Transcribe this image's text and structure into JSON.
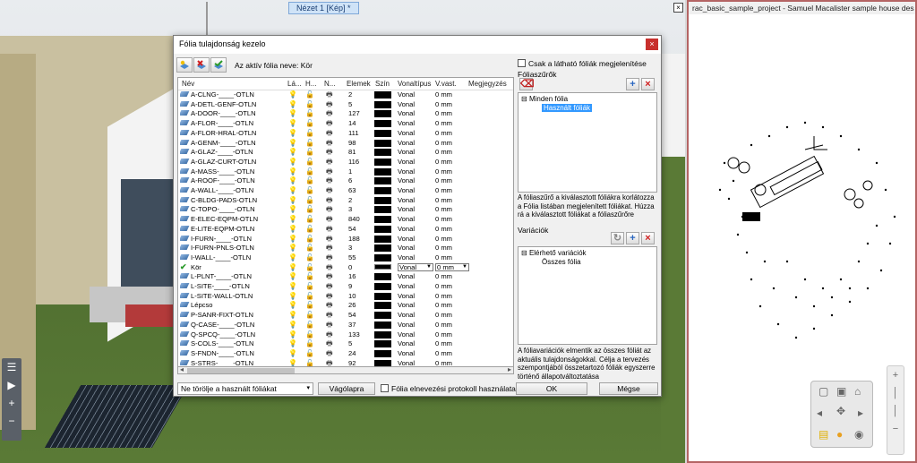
{
  "viewport": {
    "tab_label": "Nézet 1 [Kép] *",
    "close_glyph": "×",
    "tools": [
      "☰",
      "▶",
      "+",
      "−"
    ]
  },
  "view2d": {
    "title": "rac_basic_sample_project - Samuel Macalister sample house des"
  },
  "navcube": {
    "icons": [
      "cube-icon",
      "cube-top-icon",
      "house-icon",
      "arrow-left-icon",
      "orbit-icon",
      "arrow-right-icon",
      "panel-icon",
      "sun-icon",
      "eye-icon"
    ]
  },
  "dialog": {
    "title": "Fólia tulajdonság kezelo",
    "close_glyph": "×",
    "active_layer_label": "Az aktív fólia neve: Kör",
    "columns": [
      "Név",
      "Lá...",
      "H...",
      "N...",
      "Elemek",
      "Szín",
      "Vonaltípus",
      "V.vast.",
      "Megjegyzés"
    ],
    "current_row": {
      "name": "Kör",
      "count": "0",
      "line_type": "Vonal",
      "width": "0 mm"
    },
    "rows": [
      {
        "name": "A-CLNG-____-OTLN",
        "count": "2",
        "line_type": "Vonal",
        "width": "0 mm"
      },
      {
        "name": "A-DETL-GENF-OTLN",
        "count": "5",
        "line_type": "Vonal",
        "width": "0 mm"
      },
      {
        "name": "A-DOOR-____-OTLN",
        "count": "127",
        "line_type": "Vonal",
        "width": "0 mm"
      },
      {
        "name": "A-FLOR-____-OTLN",
        "count": "14",
        "line_type": "Vonal",
        "width": "0 mm"
      },
      {
        "name": "A-FLOR-HRAL-OTLN",
        "count": "111",
        "line_type": "Vonal",
        "width": "0 mm"
      },
      {
        "name": "A-GENM-____-OTLN",
        "count": "98",
        "line_type": "Vonal",
        "width": "0 mm"
      },
      {
        "name": "A-GLAZ-____-OTLN",
        "count": "81",
        "line_type": "Vonal",
        "width": "0 mm"
      },
      {
        "name": "A-GLAZ-CURT-OTLN",
        "count": "116",
        "line_type": "Vonal",
        "width": "0 mm"
      },
      {
        "name": "A-MASS-____-OTLN",
        "count": "1",
        "line_type": "Vonal",
        "width": "0 mm"
      },
      {
        "name": "A-ROOF-____-OTLN",
        "count": "6",
        "line_type": "Vonal",
        "width": "0 mm"
      },
      {
        "name": "A-WALL-____-OTLN",
        "count": "63",
        "line_type": "Vonal",
        "width": "0 mm"
      },
      {
        "name": "C-BLDG-PADS-OTLN",
        "count": "2",
        "line_type": "Vonal",
        "width": "0 mm"
      },
      {
        "name": "C-TOPO-____-OTLN",
        "count": "3",
        "line_type": "Vonal",
        "width": "0 mm"
      },
      {
        "name": "E-ELEC-EQPM-OTLN",
        "count": "840",
        "line_type": "Vonal",
        "width": "0 mm"
      },
      {
        "name": "E-LITE-EQPM-OTLN",
        "count": "54",
        "line_type": "Vonal",
        "width": "0 mm"
      },
      {
        "name": "I-FURN-____-OTLN",
        "count": "188",
        "line_type": "Vonal",
        "width": "0 mm"
      },
      {
        "name": "I-FURN-PNLS-OTLN",
        "count": "3",
        "line_type": "Vonal",
        "width": "0 mm"
      },
      {
        "name": "I-WALL-____-OTLN",
        "count": "55",
        "line_type": "Vonal",
        "width": "0 mm"
      },
      {
        "name": "L-PLNT-____-OTLN",
        "count": "16",
        "line_type": "Vonal",
        "width": "0 mm"
      },
      {
        "name": "L-SITE-____-OTLN",
        "count": "9",
        "line_type": "Vonal",
        "width": "0 mm"
      },
      {
        "name": "L-SITE-WALL-OTLN",
        "count": "10",
        "line_type": "Vonal",
        "width": "0 mm"
      },
      {
        "name": "Lépcso",
        "count": "26",
        "line_type": "Vonal",
        "width": "0 mm"
      },
      {
        "name": "P-SANR-FIXT-OTLN",
        "count": "54",
        "line_type": "Vonal",
        "width": "0 mm"
      },
      {
        "name": "Q-CASE-____-OTLN",
        "count": "37",
        "line_type": "Vonal",
        "width": "0 mm"
      },
      {
        "name": "Q-SPCQ-____-OTLN",
        "count": "133",
        "line_type": "Vonal",
        "width": "0 mm"
      },
      {
        "name": "S-COLS-____-OTLN",
        "count": "5",
        "line_type": "Vonal",
        "width": "0 mm"
      },
      {
        "name": "S-FNDN-____-OTLN",
        "count": "24",
        "line_type": "Vonal",
        "width": "0 mm"
      },
      {
        "name": "S-STRS-____-OTLN",
        "count": "92",
        "line_type": "Vonal",
        "width": "0 mm"
      }
    ],
    "current_row_index": 18,
    "bottom_select": "Ne törölje a használt fóliákat",
    "clipboard_button": "Vágólapra",
    "protocol_checkbox": "Fólia elnevezési protokoll használata",
    "ok_button": "OK",
    "cancel_button": "Mégse",
    "visible_only_checkbox": "Csak a látható fóliák megjelenítése",
    "filters_title": "Fóliaszűrők",
    "filter_tree": {
      "root": "Minden fólia",
      "child": "Használt fóliák"
    },
    "filters_desc": "A fóliaszűrő a kiválasztott fóliákra korlátozza a Fólia listában megjelenített fóliákat. Húzza rá a kiválasztott fóliákat a fóliaszűrőre",
    "variations_title": "Variációk",
    "variation_tree": {
      "root": "Elérhető variációk",
      "child": "Összes fólia"
    },
    "variations_desc": "A fóliavariációk elmentik az összes fóliát az aktuális tulajdonságokkal. Célja a tervezés szempontjából összetartozó fóliák egyszerre történő állapotváltoztatása"
  }
}
